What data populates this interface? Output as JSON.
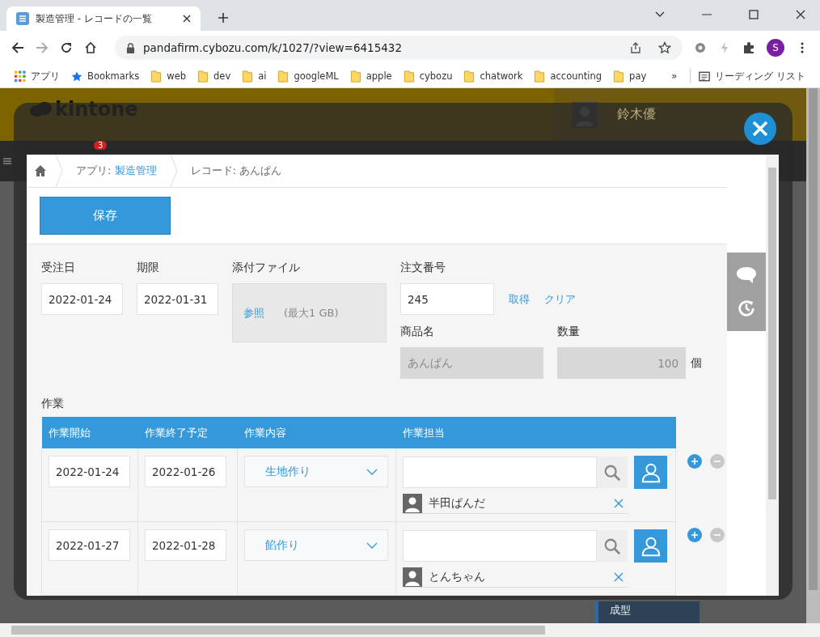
{
  "browser": {
    "tab_title": "製造管理 - レコードの一覧",
    "url": "pandafirm.cybozu.com/k/1027/?view=6415432",
    "profile_initial": "S",
    "bookmarks": [
      {
        "label": "アプリ",
        "kind": "apps"
      },
      {
        "label": "Bookmarks",
        "kind": "star"
      },
      {
        "label": "web",
        "kind": "folder"
      },
      {
        "label": "dev",
        "kind": "folder"
      },
      {
        "label": "ai",
        "kind": "folder"
      },
      {
        "label": "googleML",
        "kind": "folder"
      },
      {
        "label": "apple",
        "kind": "folder"
      },
      {
        "label": "cybozu",
        "kind": "folder"
      },
      {
        "label": "chatwork",
        "kind": "folder"
      },
      {
        "label": "accounting",
        "kind": "folder"
      },
      {
        "label": "pay",
        "kind": "folder"
      }
    ],
    "overflow": "»",
    "reading_list": "リーディング リスト"
  },
  "background": {
    "app_name": "kintone",
    "user": "鈴木優",
    "notification_count": "3",
    "calendar_entry": "成型"
  },
  "dialog": {
    "breadcrumb": {
      "app_prefix": "アプリ:",
      "app_link": "製造管理",
      "record": "レコード: あんぱん"
    },
    "save_button": "保存",
    "fields": {
      "order_date": {
        "label": "受注日",
        "value": "2022-01-24"
      },
      "due": {
        "label": "期限",
        "value": "2022-01-31"
      },
      "attachment": {
        "label": "添付ファイル",
        "browse": "参照",
        "limit": "(最大1 GB)"
      },
      "order_no": {
        "label": "注文番号",
        "value": "245",
        "actions": [
          "取得",
          "クリア"
        ]
      },
      "product": {
        "label": "商品名",
        "value": "あんぱん",
        "disabled": true
      },
      "quantity": {
        "label": "数量",
        "value": "100",
        "unit": "個",
        "disabled": true
      }
    },
    "table": {
      "label": "作業",
      "columns": [
        "作業開始",
        "作業終了予定",
        "作業内容",
        "作業担当"
      ],
      "rows": [
        {
          "start": "2022-01-24",
          "end": "2022-01-26",
          "task": "生地作り",
          "assignees": [
            "半田ぱんだ"
          ]
        },
        {
          "start": "2022-01-27",
          "end": "2022-01-28",
          "task": "餡作り",
          "assignees": [
            "とんちゃん"
          ]
        }
      ]
    }
  }
}
